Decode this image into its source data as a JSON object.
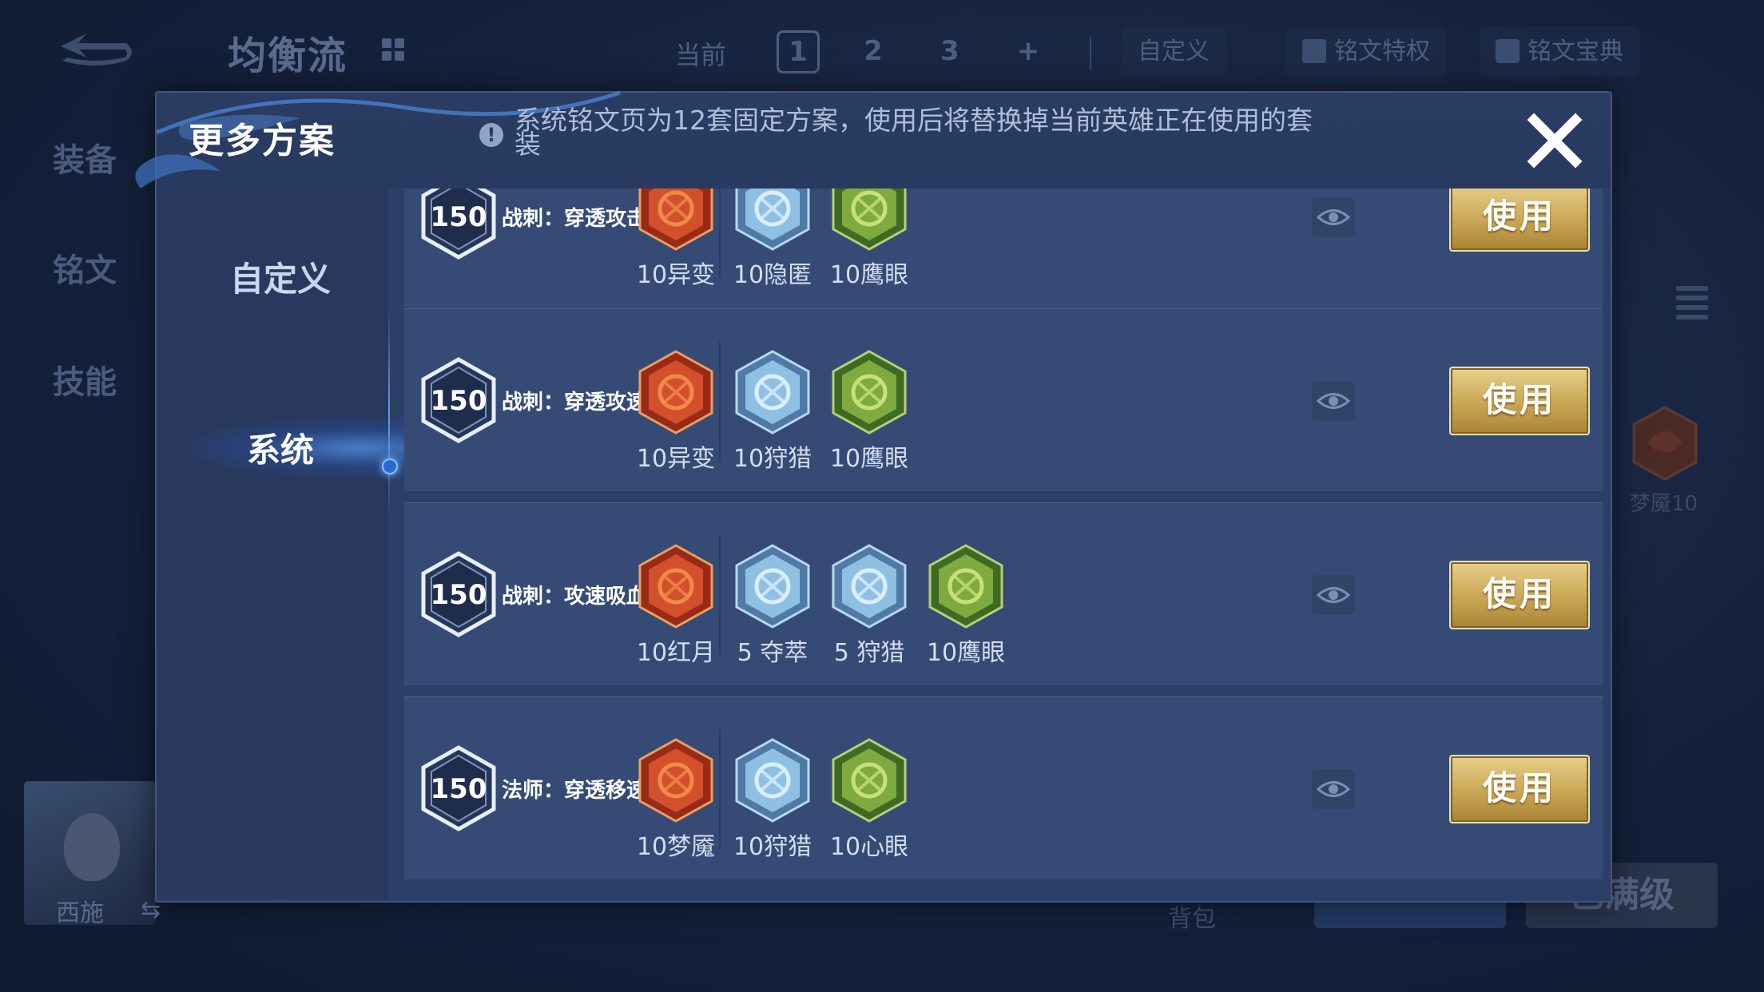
{
  "background": {
    "title": "均衡流",
    "page_label": "当前",
    "pages": [
      "1",
      "2",
      "3",
      "+"
    ],
    "custom_label": "自定义",
    "privilege_label": "铭文特权",
    "codex_label": "铭文宝典",
    "left_nav": [
      "装备",
      "铭文",
      "技能"
    ],
    "hero_name": "西施",
    "bag_label": "背包",
    "max_level_label": "已满级",
    "right_rune_label": "梦魇10"
  },
  "modal": {
    "title": "更多方案",
    "info_text": "系统铭文页为12套固定方案，使用后将替换掉当前英雄正在使用的套装",
    "tabs": [
      {
        "label": "自定义"
      },
      {
        "label": "系统"
      }
    ],
    "rows": [
      {
        "level": "150",
        "name": "战刺：穿透攻击",
        "runes": [
          {
            "label": "10异变",
            "color": "red",
            "icon": "mutation-rune-icon"
          },
          {
            "label": "10隐匿",
            "color": "blue",
            "icon": "stealth-rune-icon"
          },
          {
            "label": "10鹰眼",
            "color": "green",
            "icon": "hawkeye-rune-icon"
          }
        ],
        "use_label": "使用"
      },
      {
        "level": "150",
        "name": "战刺：穿透攻速",
        "runes": [
          {
            "label": "10异变",
            "color": "red",
            "icon": "mutation-rune-icon"
          },
          {
            "label": "10狩猎",
            "color": "blue",
            "icon": "hunt-rune-icon"
          },
          {
            "label": "10鹰眼",
            "color": "green",
            "icon": "hawkeye-rune-icon"
          }
        ],
        "use_label": "使用"
      },
      {
        "level": "150",
        "name": "战刺：攻速吸血",
        "runes": [
          {
            "label": "10红月",
            "color": "red",
            "icon": "red-moon-rune-icon"
          },
          {
            "label": "5 夺萃",
            "color": "blue",
            "icon": "plunder-rune-icon"
          },
          {
            "label": "5 狩猎",
            "color": "blue",
            "icon": "hunt-rune-icon"
          },
          {
            "label": "10鹰眼",
            "color": "green",
            "icon": "hawkeye-rune-icon"
          }
        ],
        "use_label": "使用"
      },
      {
        "level": "150",
        "name": "法师：穿透移速",
        "runes": [
          {
            "label": "10梦魇",
            "color": "red",
            "icon": "nightmare-rune-icon"
          },
          {
            "label": "10狩猎",
            "color": "blue",
            "icon": "hunt-rune-icon"
          },
          {
            "label": "10心眼",
            "color": "green",
            "icon": "mind-eye-rune-icon"
          }
        ],
        "use_label": "使用"
      }
    ]
  },
  "colors": {
    "rune_red": "#c8452a",
    "rune_blue": "#5b8fc4",
    "rune_green": "#6f9a3a",
    "use_button_gold": "#c9a654",
    "panel_bg": "#2c3f66"
  }
}
